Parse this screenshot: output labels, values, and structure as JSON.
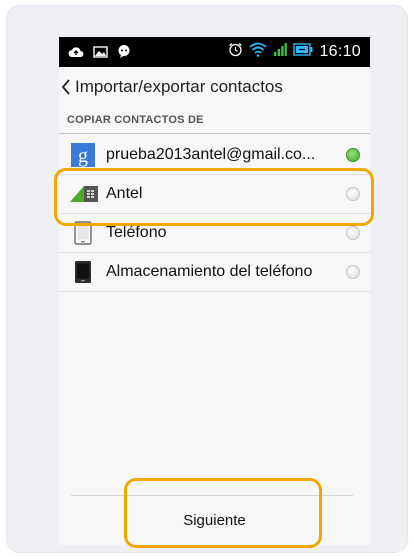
{
  "status_bar": {
    "time": "16:10",
    "left_icons": [
      "cloud-upload-icon",
      "image-icon",
      "messenger-icon"
    ],
    "right_icons": [
      "alarm-icon",
      "wifi-icon",
      "signal-icon",
      "battery-icon"
    ]
  },
  "action_bar": {
    "title": "Importar/exportar contactos"
  },
  "section": {
    "header": "COPIAR CONTACTOS DE"
  },
  "sources": [
    {
      "label": "prueba2013antel@gmail.co...",
      "icon": "google-icon",
      "selected": true
    },
    {
      "label": "Antel",
      "icon": "sim-card-icon",
      "selected": false
    },
    {
      "label": "Teléfono",
      "icon": "phone-outline-icon",
      "selected": false
    },
    {
      "label": "Almacenamiento del teléfono",
      "icon": "phone-storage-icon",
      "selected": false
    }
  ],
  "footer": {
    "next_label": "Siguiente"
  },
  "colors": {
    "highlight": "#f0a800",
    "radio_selected": "#3da829",
    "google_blue": "#3b7bd8"
  }
}
